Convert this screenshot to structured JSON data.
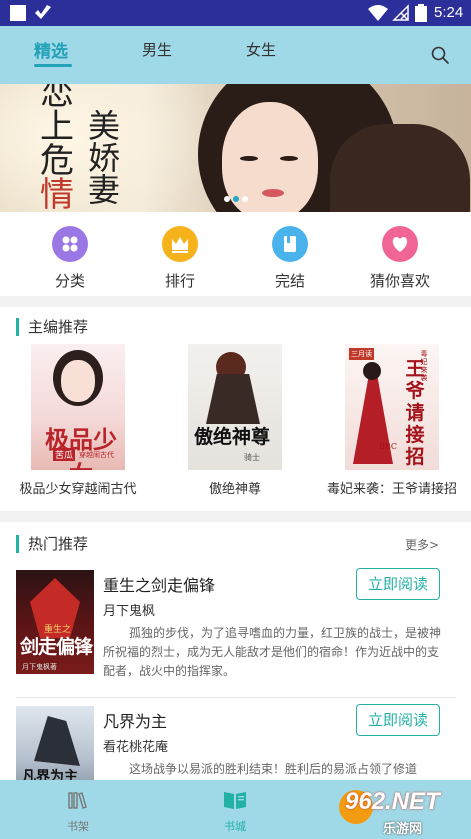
{
  "status_bar": {
    "time": "5:24"
  },
  "top_tabs": [
    {
      "label": "精选",
      "active": true
    },
    {
      "label": "男生",
      "active": false
    },
    {
      "label": "女生",
      "active": false
    }
  ],
  "search_icon": "search-icon",
  "banner": {
    "title_chars_left": [
      "恋",
      "上",
      "危",
      "情"
    ],
    "title_chars_right": [
      "美",
      "娇",
      "妻"
    ],
    "page_count": 3,
    "active_page": 1
  },
  "categories": [
    {
      "label": "分类",
      "icon": "grid-icon",
      "color": "#9b77e6"
    },
    {
      "label": "排行",
      "icon": "crown-icon",
      "color": "#f5b21b"
    },
    {
      "label": "完结",
      "icon": "book-icon",
      "color": "#4ab3ec"
    },
    {
      "label": "猜你喜欢",
      "icon": "heart-icon",
      "color": "#f06595"
    }
  ],
  "editor_picks": {
    "title": "主编推荐",
    "books": [
      {
        "title": "极品少女穿越闹古代",
        "cover_text": "极品少女",
        "cover_sub": "苦瓜",
        "cover_sub2": "穿越闹古代"
      },
      {
        "title": "傲绝神尊",
        "cover_text": "傲绝神尊",
        "cover_sub": "骑士"
      },
      {
        "title": "毒妃来袭：王爷请接招",
        "cover_text": "王爷请接招",
        "cover_sub": "毒妃来袭",
        "cover_badge": "三月读",
        "cover_sub2": "BBC"
      }
    ]
  },
  "hot_picks": {
    "title": "热门推荐",
    "more_label": "更多>",
    "books": [
      {
        "title": "重生之剑走偏锋",
        "author": "月下鬼枫",
        "description": "孤独的步伐，为了追寻嗜血的力量，红卫族的战士，是被神所祝福的烈士，成为无人能敌才是他们的宿命！作为近战中的支配者，战火中的指挥家。",
        "button": "立即阅读",
        "cover_text": "剑走偏锋",
        "cover_sub": "重生之",
        "cover_author": "月下鬼枫著"
      },
      {
        "title": "凡界为主",
        "author": "看花桃花庵",
        "description": "这场战争以易派的胜利结束！胜利后的易派占领了修道",
        "button": "立即阅读",
        "cover_text": "凡界为主"
      }
    ]
  },
  "bottom_nav": [
    {
      "label": "书架",
      "icon": "bookshelf-icon",
      "active": false
    },
    {
      "label": "书城",
      "icon": "bookstore-icon",
      "active": true
    }
  ],
  "watermark": {
    "text": "962.NET",
    "subtext": "乐游网"
  },
  "colors": {
    "accent": "#23b0a6",
    "header_bg": "#9fd8e6",
    "status_bar_bg": "#2c2e9a"
  }
}
